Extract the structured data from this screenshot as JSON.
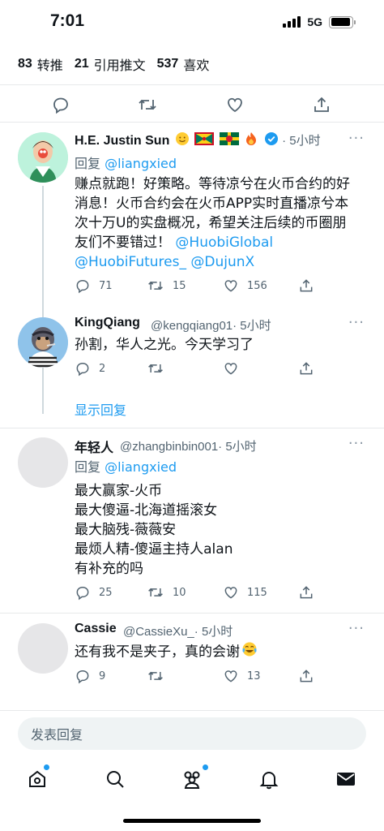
{
  "status_bar": {
    "time": "7:01",
    "network": "5G",
    "battery_level": 0.92
  },
  "stats": [
    {
      "count": "83",
      "label": "转推"
    },
    {
      "count": "21",
      "label": "引用推文"
    },
    {
      "count": "537",
      "label": "喜欢"
    }
  ],
  "tweets": [
    {
      "name": "H.E. Justin Sun",
      "handle": "",
      "time": "· 5小时",
      "verified": true,
      "reply_prefix": "回复",
      "reply_to": "@liangxied",
      "lines": [
        {
          "text": "赚点就跑！好策略。等待凉兮在火币合约的好"
        },
        {
          "text": "消息！火币合约会在火币APP实时直播凉兮本"
        },
        {
          "text": "次十万U的实盘概况，希望关注后续的币圈朋"
        },
        {
          "text": "友们不要错过！",
          "mention": "@HuobiGlobal"
        },
        {
          "text": "",
          "mention": "@HuobiFutures_ @DujunX"
        }
      ],
      "replies": "71",
      "retweets": "15",
      "likes": "156"
    },
    {
      "name": "KingQiang",
      "handle": "@kengqiang01",
      "time": "· 5小时",
      "lines": [
        {
          "text": "孙割，华人之光。今天学习了"
        }
      ],
      "replies": "2",
      "retweets": "",
      "likes": "",
      "show_replies": "显示回复"
    },
    {
      "name": "年轻人",
      "handle": "@zhangbinbin001",
      "time": "· 5小时",
      "reply_prefix": "回复",
      "reply_to": "@liangxied",
      "lines": [
        {
          "text": "最大赢家-火币"
        },
        {
          "text": "最大傻逼-北海道摇滚女"
        },
        {
          "text": "最大脑残-薇薇安"
        },
        {
          "text": "最烦人精-傻逼主持人alan"
        },
        {
          "text": "有补充的吗"
        }
      ],
      "replies": "25",
      "retweets": "10",
      "likes": "115"
    },
    {
      "name": "Cassie",
      "handle": "@CassieXu_",
      "time": "· 5小时",
      "lines": [
        {
          "text": "还有我不是夹子，真的会谢"
        }
      ],
      "replies": "9",
      "retweets": "",
      "likes": "13"
    }
  ],
  "reply_placeholder": "发表回复",
  "tabs": [
    "home-icon",
    "search-icon",
    "communities-icon",
    "notifications-icon",
    "messages-icon"
  ],
  "colors": {
    "accent": "#1d9bf0",
    "secondary_text": "#536471",
    "divider": "#e7e9ea"
  }
}
